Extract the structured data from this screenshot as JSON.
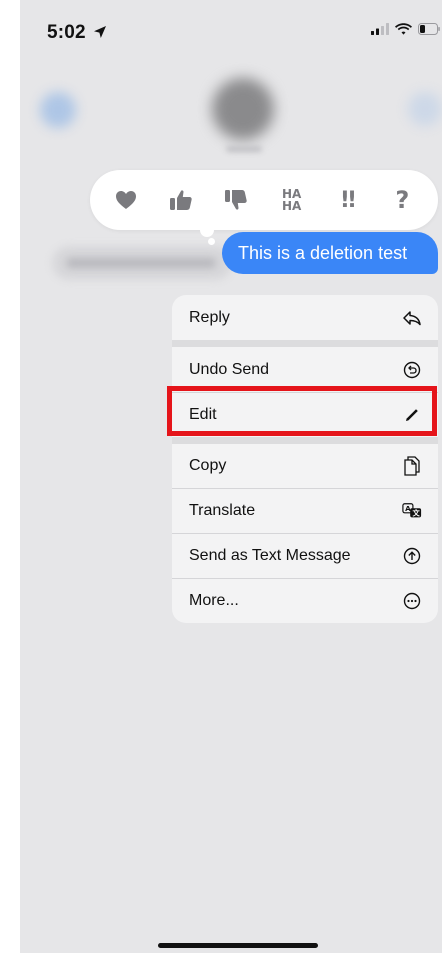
{
  "status_bar": {
    "time": "5:02",
    "location_icon": "location-arrow-icon",
    "signal_icon": "cellular-signal-icon",
    "wifi_icon": "wifi-icon",
    "battery_icon": "battery-icon"
  },
  "tapback": {
    "items": [
      {
        "name": "heart",
        "icon": "heart-icon"
      },
      {
        "name": "thumbs-up",
        "icon": "thumbs-up-icon"
      },
      {
        "name": "thumbs-down",
        "icon": "thumbs-down-icon"
      },
      {
        "name": "haha",
        "line1": "HA",
        "line2": "HA"
      },
      {
        "name": "exclamation",
        "text": "!!"
      },
      {
        "name": "question",
        "text": "?"
      }
    ]
  },
  "message": {
    "text": "This is a deletion test",
    "color": "#3a86f7"
  },
  "menu": {
    "items": [
      {
        "label": "Reply",
        "icon": "reply-icon"
      },
      {
        "label": "Undo Send",
        "icon": "undo-send-icon"
      },
      {
        "label": "Edit",
        "icon": "pencil-icon"
      },
      {
        "label": "Copy",
        "icon": "copy-icon"
      },
      {
        "label": "Translate",
        "icon": "translate-icon"
      },
      {
        "label": "Send as Text Message",
        "icon": "send-arrow-up-icon"
      },
      {
        "label": "More...",
        "icon": "more-ellipsis-icon"
      }
    ]
  },
  "highlight": {
    "target": "Edit",
    "color": "#e5141a"
  }
}
